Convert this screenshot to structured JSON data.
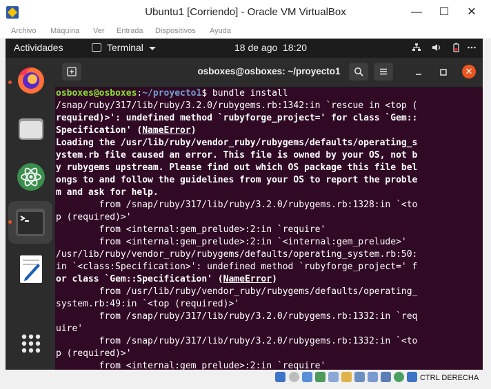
{
  "window": {
    "title": "Ubuntu1 [Corriendo] - Oracle VM VirtualBox",
    "minimize": "—",
    "maximize": "☐",
    "close": "✕"
  },
  "menubar": {
    "items": [
      "Archivo",
      "Máquina",
      "Ver",
      "Entrada",
      "Dispositivos",
      "Ayuda"
    ]
  },
  "gnome": {
    "activities": "Actividades",
    "app_menu": "Terminal",
    "date": "18 de ago",
    "time": "18:20"
  },
  "terminal": {
    "title": "osboxes@osboxes: ~/proyecto1",
    "prompt_user": "osboxes@osboxes",
    "prompt_sep": ":",
    "prompt_path": "~/proyecto1",
    "prompt_end": "$ ",
    "command": "bundle install",
    "lines": [
      "/snap/ruby/317/lib/ruby/3.2.0/rubygems.rb:1342:in `rescue in <top (",
      "required)>': undefined method `rubyforge_project=' for class `Gem::",
      "Specification' (NameError)",
      "Loading the /usr/lib/ruby/vendor_ruby/rubygems/defaults/operating_s",
      "ystem.rb file caused an error. This file is owned by your OS, not b",
      "y rubygems upstream. Please find out which OS package this file bel",
      "ongs to and follow the guidelines from your OS to report the proble",
      "m and ask for help.",
      "        from /snap/ruby/317/lib/ruby/3.2.0/rubygems.rb:1328:in `<to",
      "p (required)>'",
      "        from <internal:gem_prelude>:2:in `require'",
      "        from <internal:gem_prelude>:2:in `<internal:gem_prelude>'",
      "/usr/lib/ruby/vendor_ruby/rubygems/defaults/operating_system.rb:50:",
      "in `<class:Specification>': undefined method `rubyforge_project=' f",
      "or class `Gem::Specification' (NameError)",
      "        from /usr/lib/ruby/vendor_ruby/rubygems/defaults/operating_",
      "system.rb:49:in `<top (required)>'",
      "        from /snap/ruby/317/lib/ruby/3.2.0/rubygems.rb:1332:in `req",
      "uire'",
      "        from /snap/ruby/317/lib/ruby/3.2.0/rubygems.rb:1332:in `<to",
      "p (required)>'",
      "        from <internal:gem_prelude>:2:in `require'"
    ]
  },
  "statusbar": {
    "host_key": "CTRL DERECHA"
  },
  "colors": {
    "terminal_bg": "#300a24",
    "prompt_user": "#8ae234",
    "prompt_path": "#729fcf",
    "accent": "#e95420"
  },
  "icons": {
    "dock": [
      "firefox-icon",
      "files-icon",
      "atom-icon",
      "terminal-icon",
      "text-editor-icon",
      "show-apps-icon"
    ],
    "tray": [
      "network-icon",
      "volume-icon",
      "battery-icon",
      "system-menu-icon"
    ]
  }
}
